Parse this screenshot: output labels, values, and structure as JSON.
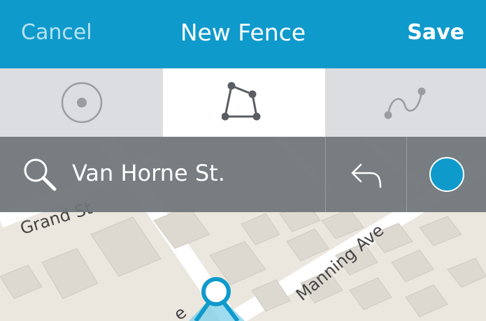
{
  "nav": {
    "cancel_label": "Cancel",
    "title": "New Fence",
    "save_label": "Save"
  },
  "tabs": [
    {
      "icon": "circle-fence-icon",
      "active": false
    },
    {
      "icon": "polygon-fence-icon",
      "active": true
    },
    {
      "icon": "route-fence-icon",
      "active": false
    }
  ],
  "search": {
    "value": "Van Horne St.",
    "icon": "search-icon"
  },
  "toolbar": {
    "undo_icon": "undo-icon",
    "color_icon": "color-swatch",
    "swatch_color": "#0f9acc"
  },
  "map": {
    "street_1": "Grand St",
    "street_2": "Manning Ave",
    "street_3_partial": "e"
  },
  "colors": {
    "accent": "#0f9acc",
    "fence_fill": "#7ccfe8",
    "tab_bg": "#dcdde0",
    "toolbar_bg": "#6e7478"
  }
}
